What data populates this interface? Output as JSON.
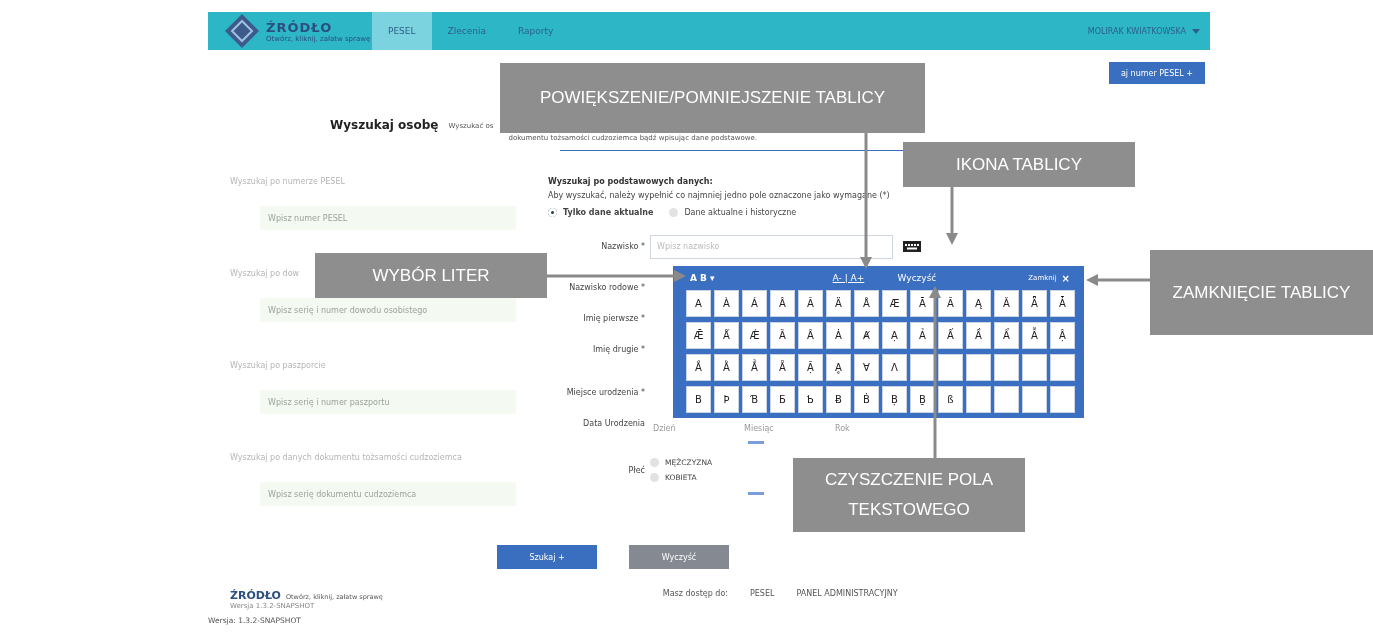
{
  "header": {
    "logo": {
      "name": "ŹRÓDŁO",
      "tagline": "Otwórz, kliknij, załatw sprawę"
    },
    "nav": [
      {
        "label": "PESEL",
        "selected": true
      },
      {
        "label": "Zlecenia",
        "selected": false
      },
      {
        "label": "Raporty",
        "selected": false
      }
    ],
    "user": {
      "name": "MOLIRAK KWIATKOWSKA"
    }
  },
  "top_button": {
    "label": "aj numer PESEL +"
  },
  "title": "Wyszukaj osobę",
  "description": [
    "Wyszukać os",
    "dokumentu tożsamości cudzoziemca bądź wpisując dane podstawowe."
  ],
  "quick_search": [
    {
      "label": "Wyszukaj po numerze PESEL",
      "placeholder": "Wpisz numer PESEL"
    },
    {
      "label": "Wyszukaj po dow",
      "placeholder": "Wpisz serię i numer dowodu osobistego"
    },
    {
      "label": "Wyszukaj po paszporcie",
      "placeholder": "Wpisz serię i numer paszportu"
    },
    {
      "label": "Wyszukaj po danych dokumentu tożsamości cudzoziemca",
      "placeholder": "Wpisz serię dokumentu cudzoziemca"
    }
  ],
  "basic_search": {
    "heading": "Wyszukaj po podstawowych danych:",
    "hint": "Aby wyszukać, należy wypełnić co najmniej jedno pole oznaczone jako wymagane (*)",
    "scope": [
      {
        "label": "Tylko dane aktualne",
        "selected": true
      },
      {
        "label": "Dane aktualne i historyczne",
        "selected": false
      }
    ],
    "fields": [
      {
        "kind": "text",
        "label": "Nazwisko *",
        "placeholder": "Wpisz nazwisko"
      },
      {
        "kind": "covered",
        "label": "Nazwisko rodowe *"
      },
      {
        "kind": "covered",
        "label": "Imię pierwsze *"
      },
      {
        "kind": "covered",
        "label": "Imię drugie *"
      },
      {
        "kind": "covered",
        "label": "Miejsce urodzenia *"
      },
      {
        "kind": "date",
        "label": "Data Urodzenia",
        "placeholders": [
          "Dzień",
          "Miesiąc",
          "Rok"
        ]
      },
      {
        "kind": "radio",
        "label": "Płeć",
        "options": [
          {
            "label": "MĘŻCZYZNA",
            "selected": false
          },
          {
            "label": "KOBIETA",
            "selected": false
          }
        ]
      }
    ]
  },
  "buttons": [
    {
      "kind": "primary",
      "label": "Szukaj +"
    },
    {
      "kind": "secondary",
      "label": "Wyczyść"
    }
  ],
  "keyboard": {
    "alphabet": "A B ▾",
    "zoom": "A- | A+",
    "clear": "Wyczyść",
    "close": "Zamknij",
    "close_icon": "×",
    "rows": [
      {
        "keys": [
          "A",
          "À",
          "Á",
          "Â",
          "Ã",
          "Ä",
          "Å",
          "Æ",
          "Ā",
          "Ă",
          "Ą",
          "Ǎ",
          "Ǟ",
          "Ǡ"
        ]
      },
      {
        "keys": [
          "Ǣ",
          "Ǻ",
          "Ǽ",
          "Ȁ",
          "Ȃ",
          "Ȧ",
          "Ⱥ",
          "Ạ",
          "Ả",
          "Ấ",
          "Ầ",
          "Ẩ",
          "Ẫ",
          "Ậ"
        ]
      },
      {
        "keys": [
          "Ắ",
          "Ằ",
          "Ẳ",
          "Ẵ",
          "Ặ",
          "Ḁ",
          "Ɐ",
          "Ʌ"
        ]
      },
      {
        "keys": [
          "B",
          "Þ",
          "Ɓ",
          "Ƃ",
          "Ƅ",
          "Ƀ",
          "Ḃ",
          "Ḅ",
          "Ḇ",
          "ß"
        ]
      }
    ]
  },
  "footer": {
    "logo": "ŹRÓDŁO",
    "tagline": "Otwórz, kliknij, załatw sprawę",
    "small_version": "Wersja 1.3.2-SNAPSHOT",
    "access_label": "Masz dostęp do:",
    "links": [
      "PESEL",
      "PANEL ADMINISTRACYJNY"
    ],
    "version": "Wersja: 1.3.2-SNAPSHOT"
  },
  "annotations": [
    {
      "text": "POWIĘKSZENIE/POMNIEJSZENIE TABLICY"
    },
    {
      "text": "IKONA TABLICY"
    },
    {
      "text": "WYBÓR LITER"
    },
    {
      "text": "ZAMKNIĘCIE TABLICY"
    },
    {
      "text": "CZYSZCZENIE POLA TEKSTOWEGO"
    }
  ]
}
